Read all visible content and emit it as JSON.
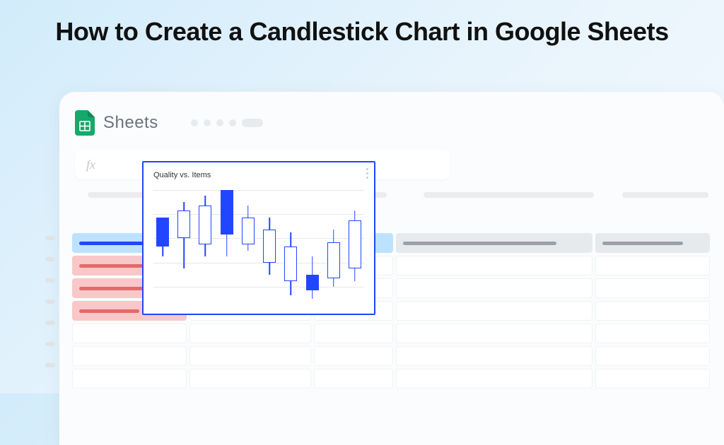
{
  "page": {
    "title": "How to Create a Candlestick Chart in Google Sheets"
  },
  "app": {
    "name": "Sheets",
    "formula_bar_label": "fx"
  },
  "chart": {
    "title": "Quality vs. Items"
  },
  "chart_data": {
    "type": "candlestick",
    "title": "Quality vs. Items",
    "xlabel": "",
    "ylabel": "",
    "ylim": [
      0,
      100
    ],
    "gridlines_y": [
      15,
      35,
      55,
      75,
      95
    ],
    "series": [
      {
        "low": 40,
        "open": 48,
        "close": 72,
        "high": 72,
        "filled": true
      },
      {
        "low": 30,
        "open": 55,
        "close": 78,
        "high": 85,
        "filled": false
      },
      {
        "low": 40,
        "open": 50,
        "close": 82,
        "high": 90,
        "filled": false
      },
      {
        "low": 40,
        "open": 58,
        "close": 95,
        "high": 95,
        "filled": true
      },
      {
        "low": 45,
        "open": 50,
        "close": 72,
        "high": 82,
        "filled": false
      },
      {
        "low": 25,
        "open": 35,
        "close": 62,
        "high": 72,
        "filled": false
      },
      {
        "low": 8,
        "open": 20,
        "close": 48,
        "high": 60,
        "filled": false
      },
      {
        "low": 5,
        "open": 12,
        "close": 25,
        "high": 40,
        "filled": true
      },
      {
        "low": 15,
        "open": 22,
        "close": 52,
        "high": 62,
        "filled": false
      },
      {
        "low": 20,
        "open": 30,
        "close": 70,
        "high": 78,
        "filled": false
      }
    ]
  }
}
